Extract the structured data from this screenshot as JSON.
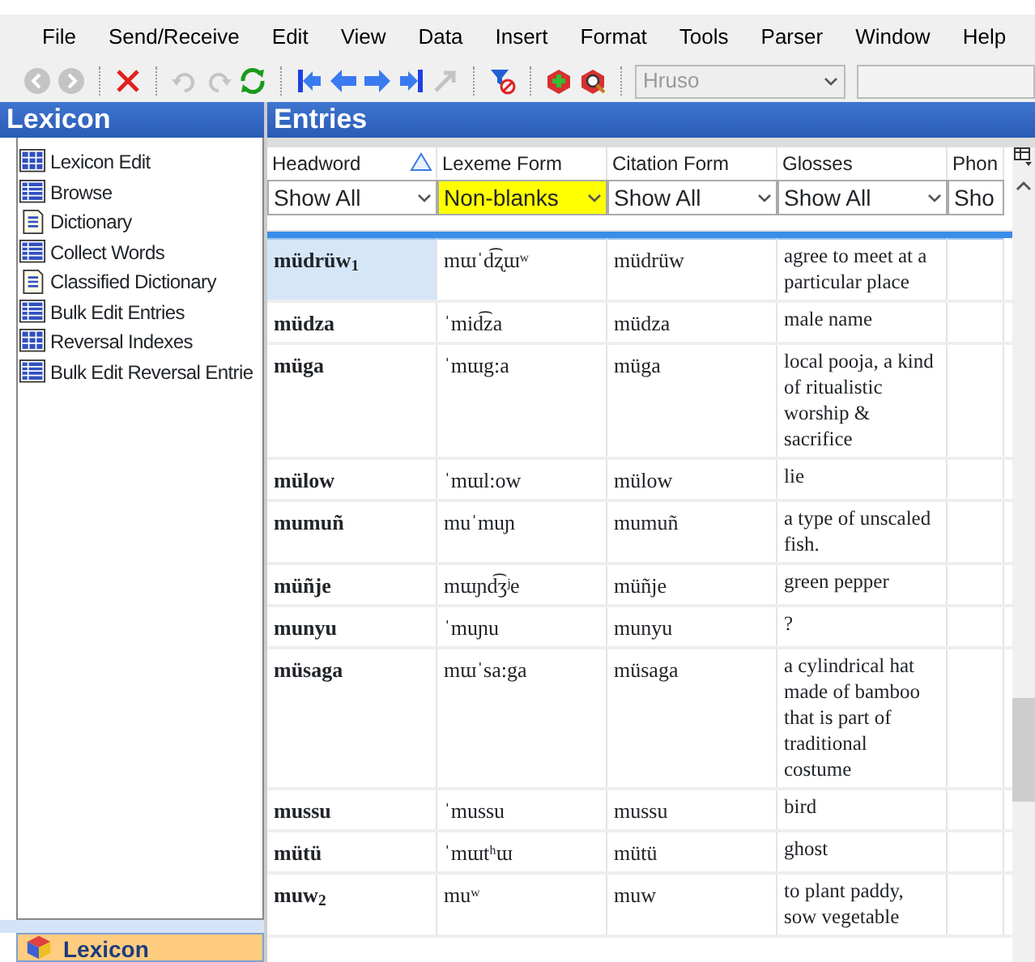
{
  "menu": [
    "File",
    "Send/Receive",
    "Edit",
    "View",
    "Data",
    "Insert",
    "Format",
    "Tools",
    "Parser",
    "Window",
    "Help"
  ],
  "toolbar": [
    {
      "kind": "back",
      "disabled": true
    },
    {
      "kind": "forward",
      "disabled": true
    },
    {
      "kind": "sep"
    },
    {
      "kind": "delete",
      "disabled": false
    },
    {
      "kind": "sep"
    },
    {
      "kind": "undo",
      "disabled": true
    },
    {
      "kind": "redo",
      "disabled": true
    },
    {
      "kind": "refresh",
      "disabled": false
    },
    {
      "kind": "sep"
    },
    {
      "kind": "first",
      "disabled": false
    },
    {
      "kind": "prev",
      "disabled": false
    },
    {
      "kind": "next",
      "disabled": false
    },
    {
      "kind": "last",
      "disabled": false
    },
    {
      "kind": "jump",
      "disabled": true
    },
    {
      "kind": "sep"
    },
    {
      "kind": "filter",
      "disabled": false
    },
    {
      "kind": "sep"
    },
    {
      "kind": "add",
      "disabled": false
    },
    {
      "kind": "find",
      "disabled": false
    },
    {
      "kind": "sep"
    }
  ],
  "writing_system_combo": {
    "value": "Hruso",
    "disabled": true
  },
  "sidebar": {
    "title": "Lexicon",
    "items": [
      {
        "label": "Lexicon Edit",
        "kind": "grid"
      },
      {
        "label": "Browse",
        "kind": "list"
      },
      {
        "label": "Dictionary",
        "kind": "doc"
      },
      {
        "label": "Collect Words",
        "kind": "list"
      },
      {
        "label": "Classified Dictionary",
        "kind": "doc"
      },
      {
        "label": "Bulk Edit Entries",
        "kind": "list"
      },
      {
        "label": "Reversal Indexes",
        "kind": "grid"
      },
      {
        "label": "Bulk Edit Reversal Entrie",
        "kind": "list"
      }
    ],
    "area_button": "Lexicon"
  },
  "entries": {
    "title": "Entries",
    "columns": [
      {
        "label": "Headword",
        "sorted": true,
        "filter": "Show All",
        "highlighted": false
      },
      {
        "label": "Lexeme Form",
        "sorted": false,
        "filter": "Non-blanks",
        "highlighted": true
      },
      {
        "label": "Citation Form",
        "sorted": false,
        "filter": "Show All",
        "highlighted": false
      },
      {
        "label": "Glosses",
        "sorted": false,
        "filter": "Show All",
        "highlighted": false
      },
      {
        "label": "Phon",
        "sorted": false,
        "filter": "Sho",
        "highlighted": false
      }
    ],
    "rows": [
      {
        "headword": "müdrüw$_{1}$",
        "lexeme": "mɯˈd͡ʐɯʷ",
        "citation": "müdrüw",
        "gloss": "agree to meet at a particular place",
        "selected": true
      },
      {
        "headword": "müdza",
        "lexeme": "ˈmid͡za",
        "citation": "müdza",
        "gloss": "male name",
        "selected": false
      },
      {
        "headword": "müga",
        "lexeme": "ˈmɯg:a",
        "citation": "müga",
        "gloss": "local pooja, a kind of ritualistic worship & sacrifice",
        "selected": false
      },
      {
        "headword": "mülow",
        "lexeme": "ˈmɯl:ow",
        "citation": "mülow",
        "gloss": "lie",
        "selected": false
      },
      {
        "headword": "mumuñ",
        "lexeme": "muˈmuɲ",
        "citation": "mumuñ",
        "gloss": "a type of unscaled fish.",
        "selected": false
      },
      {
        "headword": "müñje",
        "lexeme": "mɯɲd͡ʒʲe",
        "citation": "müñje",
        "gloss": "green pepper",
        "selected": false
      },
      {
        "headword": "munyu",
        "lexeme": "ˈmuɲu",
        "citation": "munyu",
        "gloss": "?",
        "selected": false
      },
      {
        "headword": "müsaga",
        "lexeme": "mɯˈsa:ga",
        "citation": "müsaga",
        "gloss": "a cylindrical hat made of bamboo that is part of traditional costume",
        "selected": false
      },
      {
        "headword": "mussu",
        "lexeme": "ˈmussu",
        "citation": "mussu",
        "gloss": "bird",
        "selected": false
      },
      {
        "headword": "mütü",
        "lexeme": "ˈmɯtʰɯ",
        "citation": "mütü",
        "gloss": "ghost",
        "selected": false
      },
      {
        "headword": "muw$_{2}$",
        "lexeme": "muʷ",
        "citation": "muw",
        "gloss": "to plant paddy, sow vegetable",
        "selected": false
      }
    ]
  }
}
